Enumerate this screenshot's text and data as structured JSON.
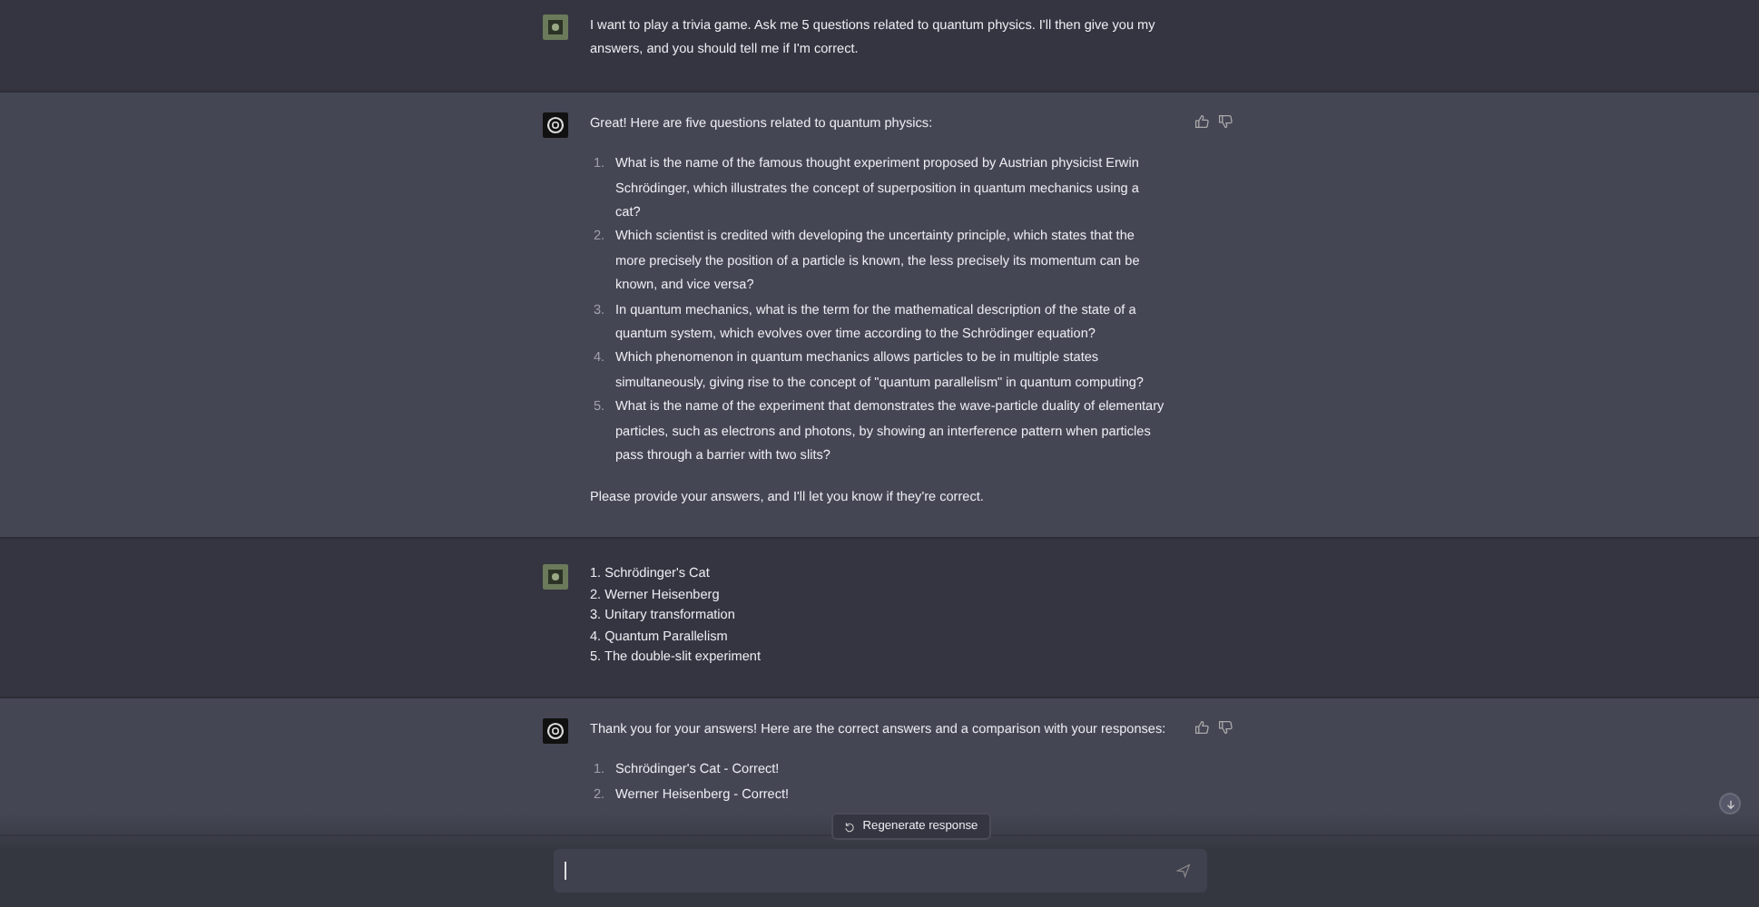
{
  "messages": [
    {
      "kind": "user",
      "blocks": [
        {
          "kind": "paragraph",
          "text": "I want to play a trivia game. Ask me 5 questions related to quantum physics. I'll then give you my answers, and you should tell me if I'm correct."
        }
      ]
    },
    {
      "kind": "assistant",
      "blocks": [
        {
          "kind": "paragraph",
          "text": "Great! Here are five questions related to quantum physics:"
        },
        {
          "kind": "list",
          "items": [
            {
              "number": "1.",
              "text": "What is the name of the famous thought experiment proposed by Austrian physicist Erwin Schrödinger, which illustrates the concept of superposition in quantum mechanics using a cat?"
            },
            {
              "number": "2.",
              "text": "Which scientist is credited with developing the uncertainty principle, which states that the more precisely the position of a particle is known, the less precisely its momentum can be known, and vice versa?"
            },
            {
              "number": "3.",
              "text": "In quantum mechanics, what is the term for the mathematical description of the state of a quantum system, which evolves over time according to the Schrödinger equation?"
            },
            {
              "number": "4.",
              "text": "Which phenomenon in quantum mechanics allows particles to be in multiple states simultaneously, giving rise to the concept of \"quantum parallelism\" in quantum computing?"
            },
            {
              "number": "5.",
              "text": "What is the name of the experiment that demonstrates the wave-particle duality of elementary particles, such as electrons and photons, by showing an interference pattern when particles pass through a barrier with two slits?"
            }
          ]
        },
        {
          "kind": "paragraph",
          "text": "Please provide your answers, and I'll let you know if they're correct."
        }
      ]
    },
    {
      "kind": "user",
      "blocks": [
        {
          "kind": "lines",
          "lines": [
            "1. Schrödinger's Cat",
            "2. Werner Heisenberg",
            "3. Unitary transformation",
            "4. Quantum Parallelism",
            "5. The double-slit experiment"
          ]
        }
      ]
    },
    {
      "kind": "assistant",
      "blocks": [
        {
          "kind": "paragraph",
          "text": "Thank you for your answers! Here are the correct answers and a comparison with your responses:"
        },
        {
          "kind": "list",
          "items": [
            {
              "number": "1.",
              "text": "Schrödinger's Cat - Correct!"
            },
            {
              "number": "2.",
              "text": "Werner Heisenberg - Correct!"
            }
          ]
        }
      ]
    }
  ],
  "regenerate_button": {
    "label": "Regenerate response"
  }
}
